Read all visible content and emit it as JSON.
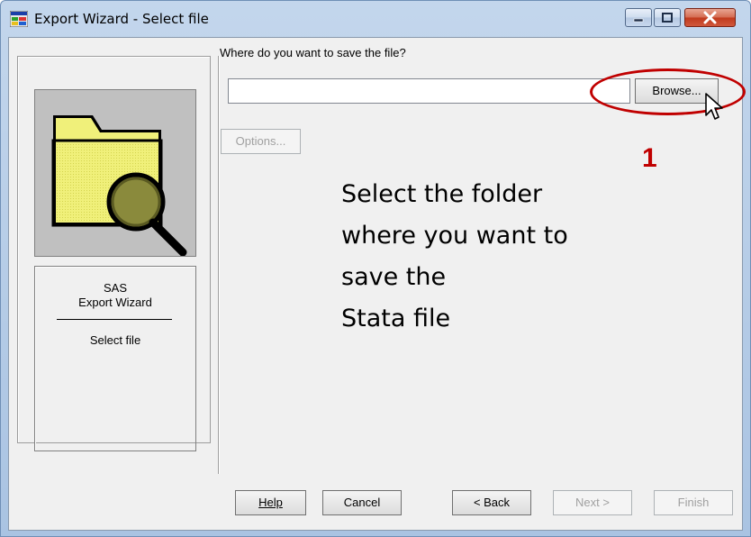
{
  "window": {
    "title": "Export Wizard - Select file"
  },
  "side_panel": {
    "product": "SAS",
    "wizard": "Export Wizard",
    "step": "Select file"
  },
  "main": {
    "question": "Where do you want to save the file?",
    "path_value": "",
    "browse_label": "Browse...",
    "options_label": "Options..."
  },
  "annotation": {
    "step_number": "1",
    "instruction_lines": [
      "Select the folder",
      "where you want to",
      "save the",
      "Stata file"
    ],
    "highlight_color": "#c00000"
  },
  "footer": {
    "help_label": "Help",
    "cancel_label": "Cancel",
    "back_label": "< Back",
    "next_label": "Next >",
    "finish_label": "Finish"
  },
  "icons": {
    "app": "sas-export-app-icon",
    "wizard_image": "folder-magnifier-icon",
    "pointer": "mouse-cursor-icon"
  },
  "colors": {
    "titlebar": "#b9cfe9",
    "close_button": "#c7432a",
    "dialog_bg": "#f0f0f0",
    "folder_yellow": "#f0f07a"
  }
}
